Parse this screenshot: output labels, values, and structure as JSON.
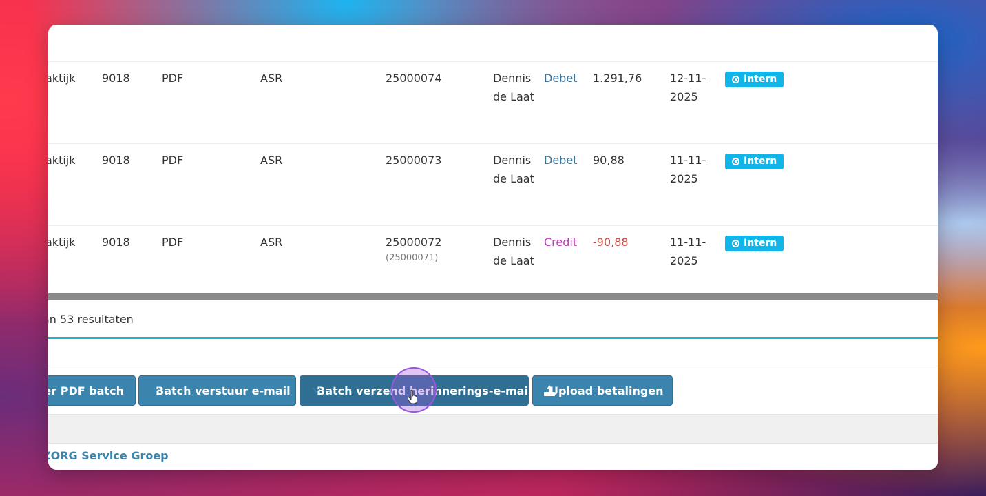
{
  "rows": [
    {
      "praktijk": "aktijk",
      "code": "9018",
      "type": "PDF",
      "insurer": "ASR",
      "factuur": "25000074",
      "factuur_ref": "",
      "name": "Dennis de Laat",
      "kind": "Debet",
      "amount": "1.291,76",
      "date": "12-11-2025",
      "badge": "Intern"
    },
    {
      "praktijk": "aktijk",
      "code": "9018",
      "type": "PDF",
      "insurer": "ASR",
      "factuur": "25000073",
      "factuur_ref": "",
      "name": "Dennis de Laat",
      "kind": "Debet",
      "amount": "90,88",
      "date": "11-11-2025",
      "badge": "Intern"
    },
    {
      "praktijk": "aktijk",
      "code": "9018",
      "type": "PDF",
      "insurer": "ASR",
      "factuur": "25000072",
      "factuur_ref": "(25000071)",
      "name": "Dennis de Laat",
      "kind": "Credit",
      "amount": "-90,88",
      "date": "11-11-2025",
      "badge": "Intern"
    }
  ],
  "results_text": "an 53 resultaten",
  "buttons": {
    "pdf_batch": "reer PDF batch",
    "batch_email": "Batch verstuur e-mail",
    "batch_reminder": "Batch verzend herinnerings-e-mail",
    "upload_payments": "Upload betalingen"
  },
  "footer_brand": "ZORG Service Groep",
  "colors": {
    "primary_button": "#3b84ad",
    "badge": "#12b5e8",
    "accent_line": "#1fb4c8",
    "credit": "#c235c2",
    "negative": "#c44e46"
  },
  "icons": {
    "badge_icon": "clock-icon",
    "email_icon": "envelope-icon",
    "upload_icon": "upload-icon",
    "cursor": "hand-pointer-icon"
  }
}
